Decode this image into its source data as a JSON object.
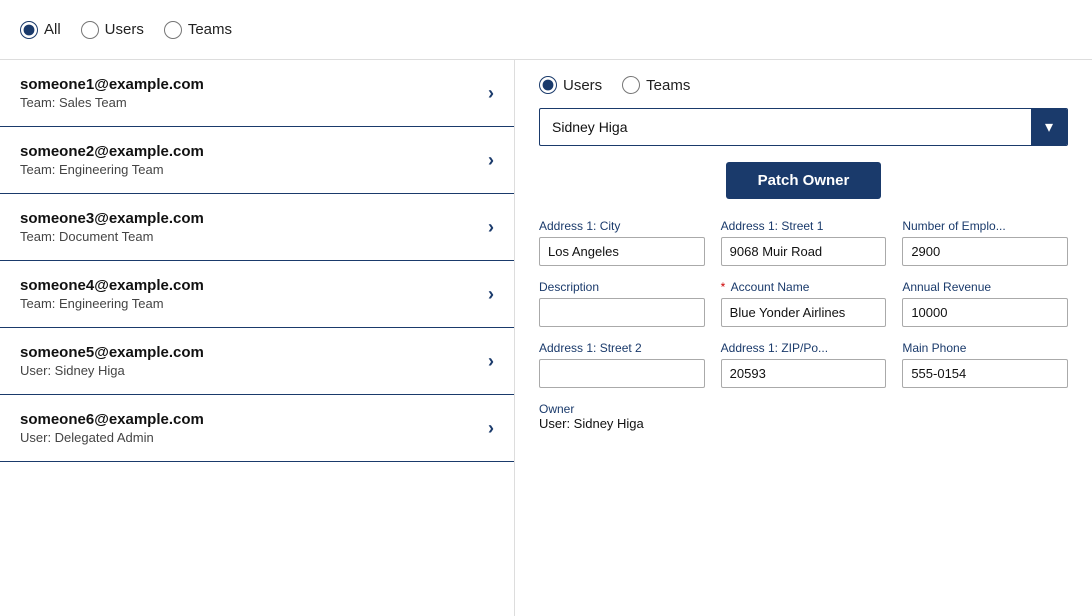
{
  "top_filter": {
    "options": [
      {
        "id": "all",
        "label": "All",
        "checked": true
      },
      {
        "id": "users",
        "label": "Users",
        "checked": false
      },
      {
        "id": "teams",
        "label": "Teams",
        "checked": false
      }
    ]
  },
  "list_items": [
    {
      "email": "someone1@example.com",
      "sub": "Team: Sales Team"
    },
    {
      "email": "someone2@example.com",
      "sub": "Team: Engineering Team"
    },
    {
      "email": "someone3@example.com",
      "sub": "Team: Document Team"
    },
    {
      "email": "someone4@example.com",
      "sub": "Team: Engineering Team"
    },
    {
      "email": "someone5@example.com",
      "sub": "User: Sidney Higa"
    },
    {
      "email": "someone6@example.com",
      "sub": "User: Delegated Admin"
    }
  ],
  "right_filter": {
    "options": [
      {
        "id": "r-users",
        "label": "Users",
        "checked": true
      },
      {
        "id": "r-teams",
        "label": "Teams",
        "checked": false
      }
    ]
  },
  "dropdown": {
    "value": "Sidney Higa",
    "btn_label": "▾"
  },
  "patch_owner_btn": "Patch Owner",
  "fields": [
    {
      "label": "Address 1: City",
      "value": "Los Angeles",
      "required": false,
      "col": 1
    },
    {
      "label": "Address 1: Street 1",
      "value": "9068 Muir Road",
      "required": false,
      "col": 2
    },
    {
      "label": "Number of Emplo...",
      "value": "2900",
      "required": false,
      "col": 3
    },
    {
      "label": "Description",
      "value": "",
      "required": false,
      "col": 1
    },
    {
      "label": "Account Name",
      "value": "Blue Yonder Airlines",
      "required": true,
      "col": 2
    },
    {
      "label": "Annual Revenue",
      "value": "10000",
      "required": false,
      "col": 3
    },
    {
      "label": "Address 1: Street 2",
      "value": "",
      "required": false,
      "col": 1
    },
    {
      "label": "Address 1: ZIP/Po...",
      "value": "20593",
      "required": false,
      "col": 2
    },
    {
      "label": "Main Phone",
      "value": "555-0154",
      "required": false,
      "col": 3
    }
  ],
  "owner": {
    "label": "Owner",
    "value": "User: Sidney Higa"
  }
}
